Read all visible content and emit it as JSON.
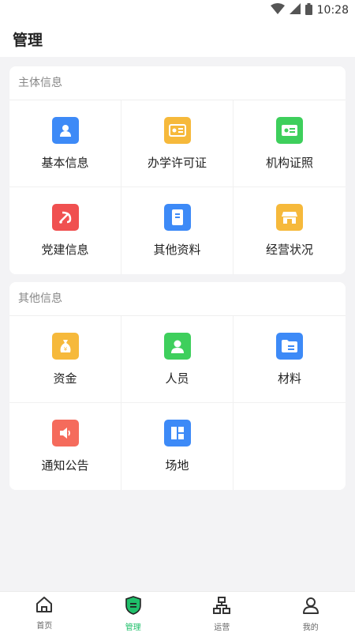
{
  "status_bar": {
    "time": "10:28",
    "icons": [
      "wifi-icon",
      "signal-icon",
      "battery-icon"
    ]
  },
  "header": {
    "title": "管理"
  },
  "sections": [
    {
      "title": "主体信息",
      "items": [
        {
          "label": "基本信息",
          "icon": "user-card-icon",
          "color": "#3d8af7"
        },
        {
          "label": "办学许可证",
          "icon": "license-icon",
          "color": "#f6b93b"
        },
        {
          "label": "机构证照",
          "icon": "id-card-icon",
          "color": "#3ecf5c"
        },
        {
          "label": "党建信息",
          "icon": "party-emblem-icon",
          "color": "#f05050"
        },
        {
          "label": "其他资料",
          "icon": "document-icon",
          "color": "#3d8af7"
        },
        {
          "label": "经营状况",
          "icon": "store-icon",
          "color": "#f6b93b"
        }
      ]
    },
    {
      "title": "其他信息",
      "items": [
        {
          "label": "资金",
          "icon": "money-bag-icon",
          "color": "#f6b93b"
        },
        {
          "label": "人员",
          "icon": "person-icon",
          "color": "#3ecf5c"
        },
        {
          "label": "材料",
          "icon": "folder-icon",
          "color": "#3d8af7"
        },
        {
          "label": "通知公告",
          "icon": "speaker-icon",
          "color": "#f56b5c"
        },
        {
          "label": "场地",
          "icon": "layout-icon",
          "color": "#3d8af7"
        }
      ]
    }
  ],
  "tabbar": {
    "active": 1,
    "tabs": [
      {
        "label": "首页",
        "icon": "home-icon"
      },
      {
        "label": "管理",
        "icon": "shield-icon"
      },
      {
        "label": "运营",
        "icon": "org-chart-icon"
      },
      {
        "label": "我的",
        "icon": "profile-icon"
      }
    ]
  }
}
